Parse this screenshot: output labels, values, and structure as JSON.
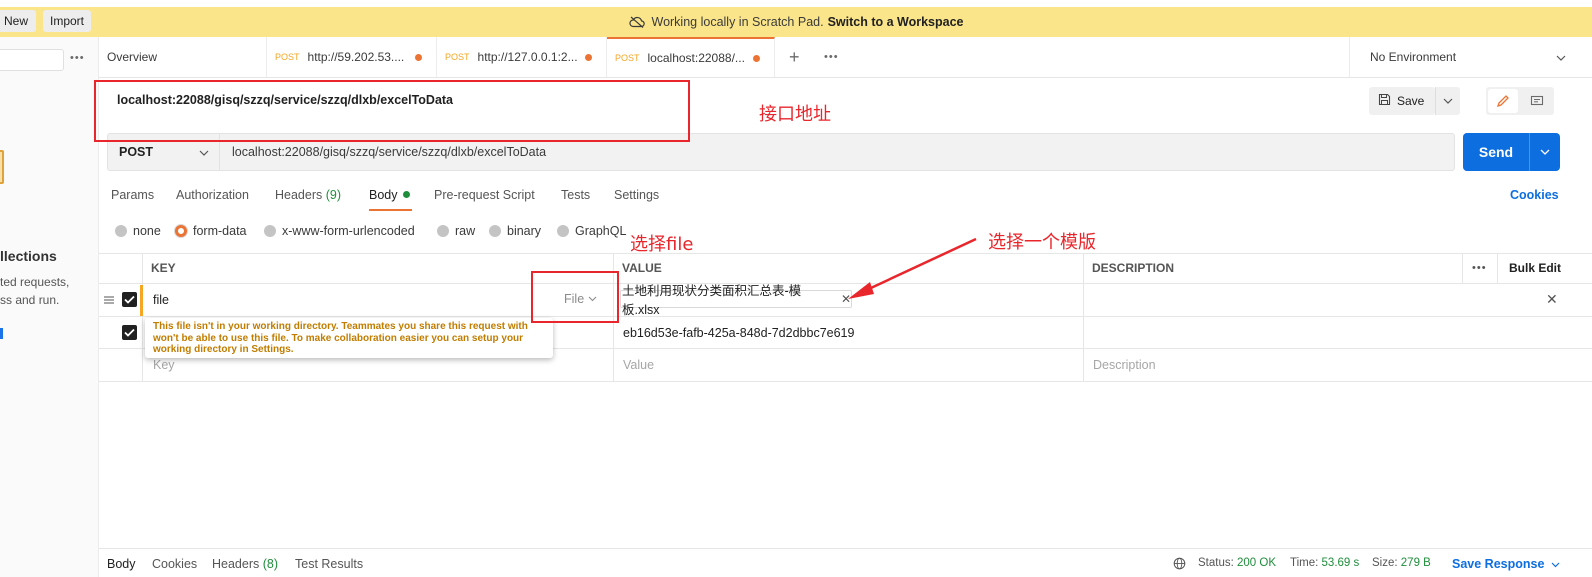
{
  "banner": {
    "text": "Working locally in Scratch Pad.",
    "link": "Switch to a Workspace"
  },
  "sidebar": {
    "new_label": "New",
    "import_label": "Import",
    "heading": "llections",
    "line1": "ted requests,",
    "line2": "ss and run."
  },
  "tabs": [
    {
      "label": "Overview"
    },
    {
      "method": "POST",
      "label": "http://59.202.53...."
    },
    {
      "method": "POST",
      "label": "http://127.0.0.1:2..."
    },
    {
      "method": "POST",
      "label": "localhost:22088/..."
    }
  ],
  "environment": {
    "label": "No Environment"
  },
  "request": {
    "title": "localhost:22088/gisq/szzq/service/szzq/dlxb/excelToData",
    "method": "POST",
    "url": "localhost:22088/gisq/szzq/service/szzq/dlxb/excelToData",
    "save_label": "Save",
    "send_label": "Send"
  },
  "request_tabs": {
    "params": "Params",
    "authorization": "Authorization",
    "headers": "Headers",
    "headers_count": "(9)",
    "body": "Body",
    "prerequest": "Pre-request Script",
    "tests": "Tests",
    "settings": "Settings",
    "cookies": "Cookies"
  },
  "body_types": [
    "none",
    "form-data",
    "x-www-form-urlencoded",
    "raw",
    "binary",
    "GraphQL"
  ],
  "selected_body_type": "form-data",
  "table": {
    "headers": {
      "key": "KEY",
      "value": "VALUE",
      "description": "DESCRIPTION",
      "bulk_edit": "Bulk Edit"
    },
    "rows": [
      {
        "checked": true,
        "key": "file",
        "type": "File",
        "value": "土地利用现状分类面积汇总表-模板.xlsx",
        "description": ""
      },
      {
        "checked": true,
        "key": "",
        "value": "eb16d53e-fafb-425a-848d-7d2dbbc7e619",
        "description": ""
      }
    ],
    "placeholder": {
      "key": "Key",
      "value": "Value",
      "description": "Description"
    },
    "tooltip": "This file isn't in your working directory. Teammates you share this request with won't be able to use this file. To make collaboration easier you can setup your working directory in Settings."
  },
  "annotations": {
    "url": "接口地址",
    "file": "选择file",
    "template": "选择一个模版"
  },
  "response": {
    "tabs": {
      "body": "Body",
      "cookies": "Cookies",
      "headers": "Headers",
      "headers_count": "(8)",
      "tests": "Test Results"
    },
    "status_label": "Status:",
    "status": "200 OK",
    "time_label": "Time:",
    "time": "53.69 s",
    "size_label": "Size:",
    "size": "279 B",
    "save_response": "Save Response"
  },
  "colors": {
    "accent": "#eb7434",
    "primary": "#0d6ee0",
    "annotation": "#e8262c",
    "banner": "#fbe58a"
  }
}
